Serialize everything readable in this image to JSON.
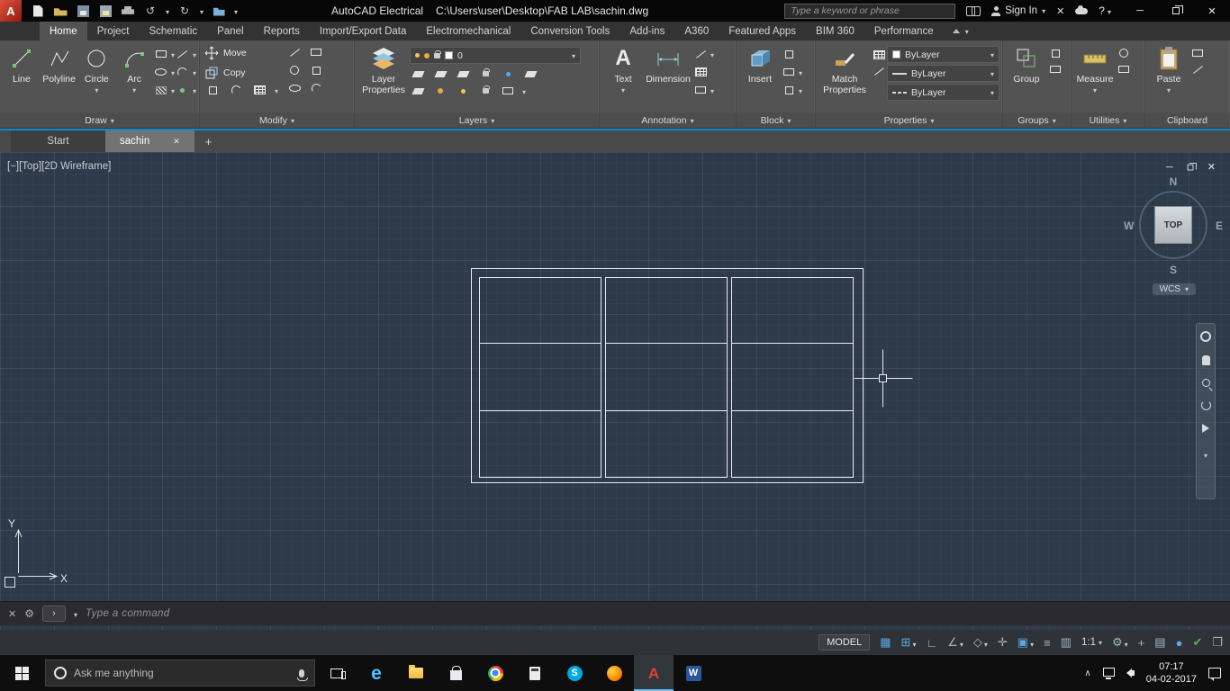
{
  "title_bar": {
    "app_name": "AutoCAD Electrical",
    "doc_path": "C:\\Users\\user\\Desktop\\FAB LAB\\sachin.dwg",
    "search_placeholder": "Type a keyword or phrase",
    "sign_in_label": "Sign In"
  },
  "ribbon": {
    "tabs": [
      "Home",
      "Project",
      "Schematic",
      "Panel",
      "Reports",
      "Import/Export Data",
      "Electromechanical",
      "Conversion Tools",
      "Add-ins",
      "A360",
      "Featured Apps",
      "BIM 360",
      "Performance"
    ],
    "active_tab": "Home",
    "draw": {
      "label": "Draw",
      "line": "Line",
      "polyline": "Polyline",
      "circle": "Circle",
      "arc": "Arc"
    },
    "modify": {
      "label": "Modify",
      "move": "Move",
      "copy": "Copy"
    },
    "layers": {
      "label": "Layers",
      "layer_properties": "Layer Properties",
      "current_layer": "0"
    },
    "annotation": {
      "label": "Annotation",
      "text": "Text",
      "dimension": "Dimension"
    },
    "block": {
      "label": "Block",
      "insert": "Insert"
    },
    "properties": {
      "label": "Properties",
      "match_properties": "Match Properties",
      "color_value": "ByLayer",
      "lineweight_value": "ByLayer",
      "linetype_value": "ByLayer"
    },
    "groups": {
      "label": "Groups",
      "group": "Group"
    },
    "utilities": {
      "label": "Utilities",
      "measure": "Measure"
    },
    "clipboard": {
      "label": "Clipboard",
      "paste": "Paste"
    }
  },
  "file_tabs": {
    "start_label": "Start",
    "active_label": "sachin"
  },
  "viewport": {
    "controls_label": "[−][Top][2D Wireframe]",
    "viewcube": {
      "north": "N",
      "east": "E",
      "south": "S",
      "west": "W",
      "face": "TOP",
      "wcs_label": "WCS"
    },
    "ucs": {
      "x": "X",
      "y": "Y"
    }
  },
  "command_line": {
    "placeholder": "Type a command"
  },
  "status_bar": {
    "model_label": "MODEL",
    "annotation_scale": "1:1"
  },
  "taskbar": {
    "search_placeholder": "Ask me anything",
    "time": "07:17",
    "date": "04-02-2017"
  },
  "icons": {
    "app_logo_letter": "A",
    "undo": "↺",
    "redo": "↻",
    "help": "?",
    "window_minimize": "─",
    "close": "✕",
    "text_tool": "A",
    "grid": "▦",
    "snap": "⊞",
    "ortho": "∟",
    "polar": "∠",
    "isometric": "◇",
    "object_snap_tracking": "✛",
    "object_snap": "▣",
    "lineweight": "≡",
    "selection_cycling": "▥",
    "gear": "⚙",
    "customization_plus": "+",
    "performance_circle": "●",
    "graphics_check": "✔",
    "clean_screen": "❒",
    "hardware_menu": "▤",
    "command_prompt": "›",
    "tray_chevron": "∧",
    "edge_letter": "e",
    "skype_letter": "S",
    "word_letter": "W",
    "autocad_letter": "A"
  }
}
